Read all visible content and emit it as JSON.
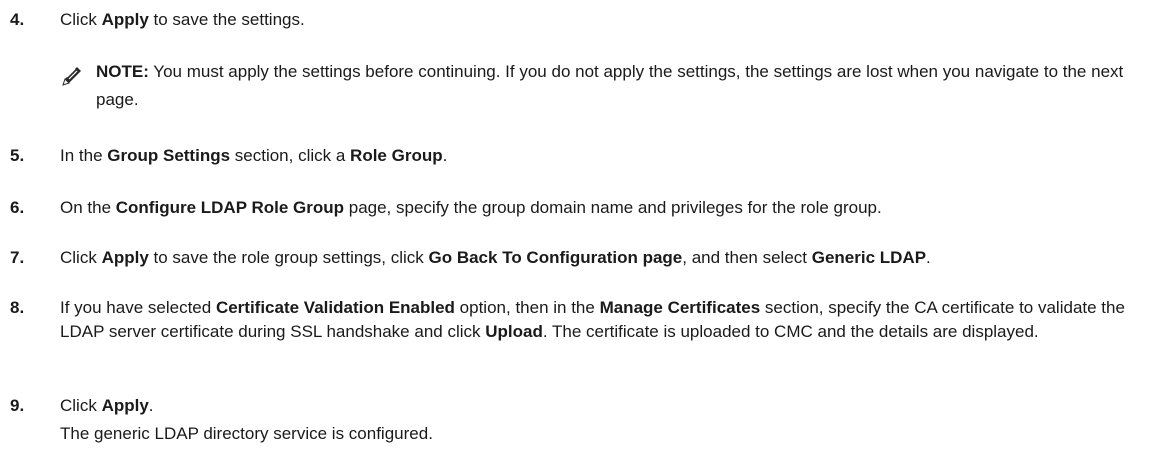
{
  "steps": [
    {
      "number": "4.",
      "parts": [
        [
          "Click ",
          false
        ],
        [
          "Apply",
          true
        ],
        [
          " to save the settings.",
          false
        ]
      ]
    },
    {
      "number": "5.",
      "parts": [
        [
          "In the ",
          false
        ],
        [
          "Group Settings",
          true
        ],
        [
          " section, click a ",
          false
        ],
        [
          "Role Group",
          true
        ],
        [
          ".",
          false
        ]
      ]
    },
    {
      "number": "6.",
      "parts": [
        [
          "On the ",
          false
        ],
        [
          "Configure LDAP Role Group",
          true
        ],
        [
          " page, specify the group domain name and privileges for the role group.",
          false
        ]
      ]
    },
    {
      "number": "7.",
      "parts": [
        [
          "Click ",
          false
        ],
        [
          "Apply",
          true
        ],
        [
          " to save the role group settings, click ",
          false
        ],
        [
          "Go Back To Configuration page",
          true
        ],
        [
          ", and then select ",
          false
        ],
        [
          "Generic LDAP",
          true
        ],
        [
          ".",
          false
        ]
      ]
    },
    {
      "number": "8.",
      "parts": [
        [
          "If you have selected ",
          false
        ],
        [
          "Certificate Validation Enabled",
          true
        ],
        [
          " option, then in the ",
          false
        ],
        [
          "Manage Certificates",
          true
        ],
        [
          " section, specify the CA certificate to validate the LDAP server certificate during SSL handshake and click ",
          false
        ],
        [
          "Upload",
          true
        ],
        [
          ". The certificate is uploaded to CMC and the details are displayed.",
          false
        ]
      ]
    },
    {
      "number": "9.",
      "parts": [
        [
          "Click ",
          false
        ],
        [
          "Apply",
          true
        ],
        [
          ".",
          false
        ]
      ]
    }
  ],
  "note": {
    "label": "NOTE:",
    "text": " You must apply the settings before continuing. If you do not apply the settings, the settings are lost when you navigate to the next page.",
    "icon": "pencil-note-icon"
  },
  "result_text": "The generic LDAP directory service is configured."
}
